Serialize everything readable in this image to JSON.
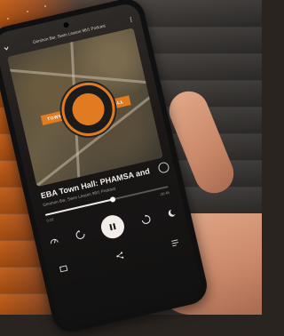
{
  "app": {
    "header_title": "Gershon Bar, Swim Lesson 98/1 Podcast"
  },
  "artwork": {
    "left_label": "TOWN",
    "right_label": "HALL"
  },
  "episode": {
    "title": "EBA Town Hall: PHAMSA and",
    "subtitle": "Gershon Bar, Swim Lesson 98/1 Podcast",
    "time_elapsed": "0:23",
    "time_remaining": "-35:45",
    "progress": 0.55
  },
  "icons": {
    "top_left": "chevron-down-icon",
    "top_right": "more-vertical-icon",
    "rewind": "rewind-icon",
    "forward": "forward-icon",
    "play_pause": "pause-icon",
    "speed": "speed-icon",
    "sleep": "sleep-timer-icon",
    "cast": "cast-icon",
    "share": "share-icon",
    "queue": "queue-icon"
  },
  "colors": {
    "accent": "#e07b22",
    "background_left": "#c25a12"
  }
}
